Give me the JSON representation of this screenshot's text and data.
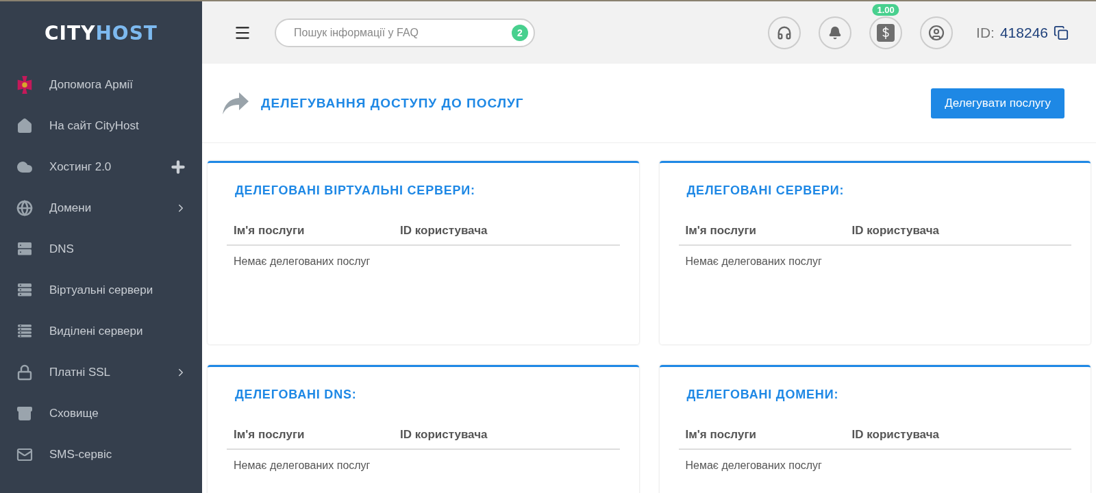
{
  "logo": {
    "part_1": "CITY",
    "part_2": "HOST"
  },
  "sidebar": {
    "items": [
      {
        "label": "Допомога Армії",
        "kind": "plain"
      },
      {
        "label": "На сайт CityHost",
        "kind": "plain"
      },
      {
        "label": "Хостинг 2.0",
        "kind": "add"
      },
      {
        "label": "Домени",
        "kind": "submenu"
      },
      {
        "label": "DNS",
        "kind": "plain"
      },
      {
        "label": "Віртуальні сервери",
        "kind": "plain"
      },
      {
        "label": "Виділені сервери",
        "kind": "plain"
      },
      {
        "label": "Платні SSL",
        "kind": "submenu"
      },
      {
        "label": "Сховище",
        "kind": "plain"
      },
      {
        "label": "SMS-сервіс",
        "kind": "plain"
      }
    ]
  },
  "topbar": {
    "search": {
      "placeholder": "Пошук інформації у FAQ",
      "badge": "2"
    },
    "balance_badge": "1.00",
    "id_label": "ID:",
    "id_value": "418246"
  },
  "page": {
    "title": "ДЕЛЕГУВАННЯ ДОСТУПУ ДО ПОСЛУГ",
    "action": "Делегувати послугу"
  },
  "cards": [
    {
      "title": "ДЕЛЕГОВАНІ ВІРТУАЛЬНІ СЕРВЕРИ:",
      "columns": [
        "Ім'я послуги",
        "ID користувача"
      ],
      "empty": "Немає делегованих послуг"
    },
    {
      "title": "ДЕЛЕГОВАНІ СЕРВЕРИ:",
      "columns": [
        "Ім'я послуги",
        "ID користувача"
      ],
      "empty": "Немає делегованих послуг"
    },
    {
      "title": "ДЕЛЕГОВАНІ DNS:",
      "columns": [
        "Ім'я послуги",
        "ID користувача"
      ],
      "empty": "Немає делегованих послуг"
    },
    {
      "title": "ДЕЛЕГОВАНІ ДОМЕНИ:",
      "columns": [
        "Ім'я послуги",
        "ID користувача"
      ],
      "empty": "Немає делегованих послуг"
    }
  ]
}
